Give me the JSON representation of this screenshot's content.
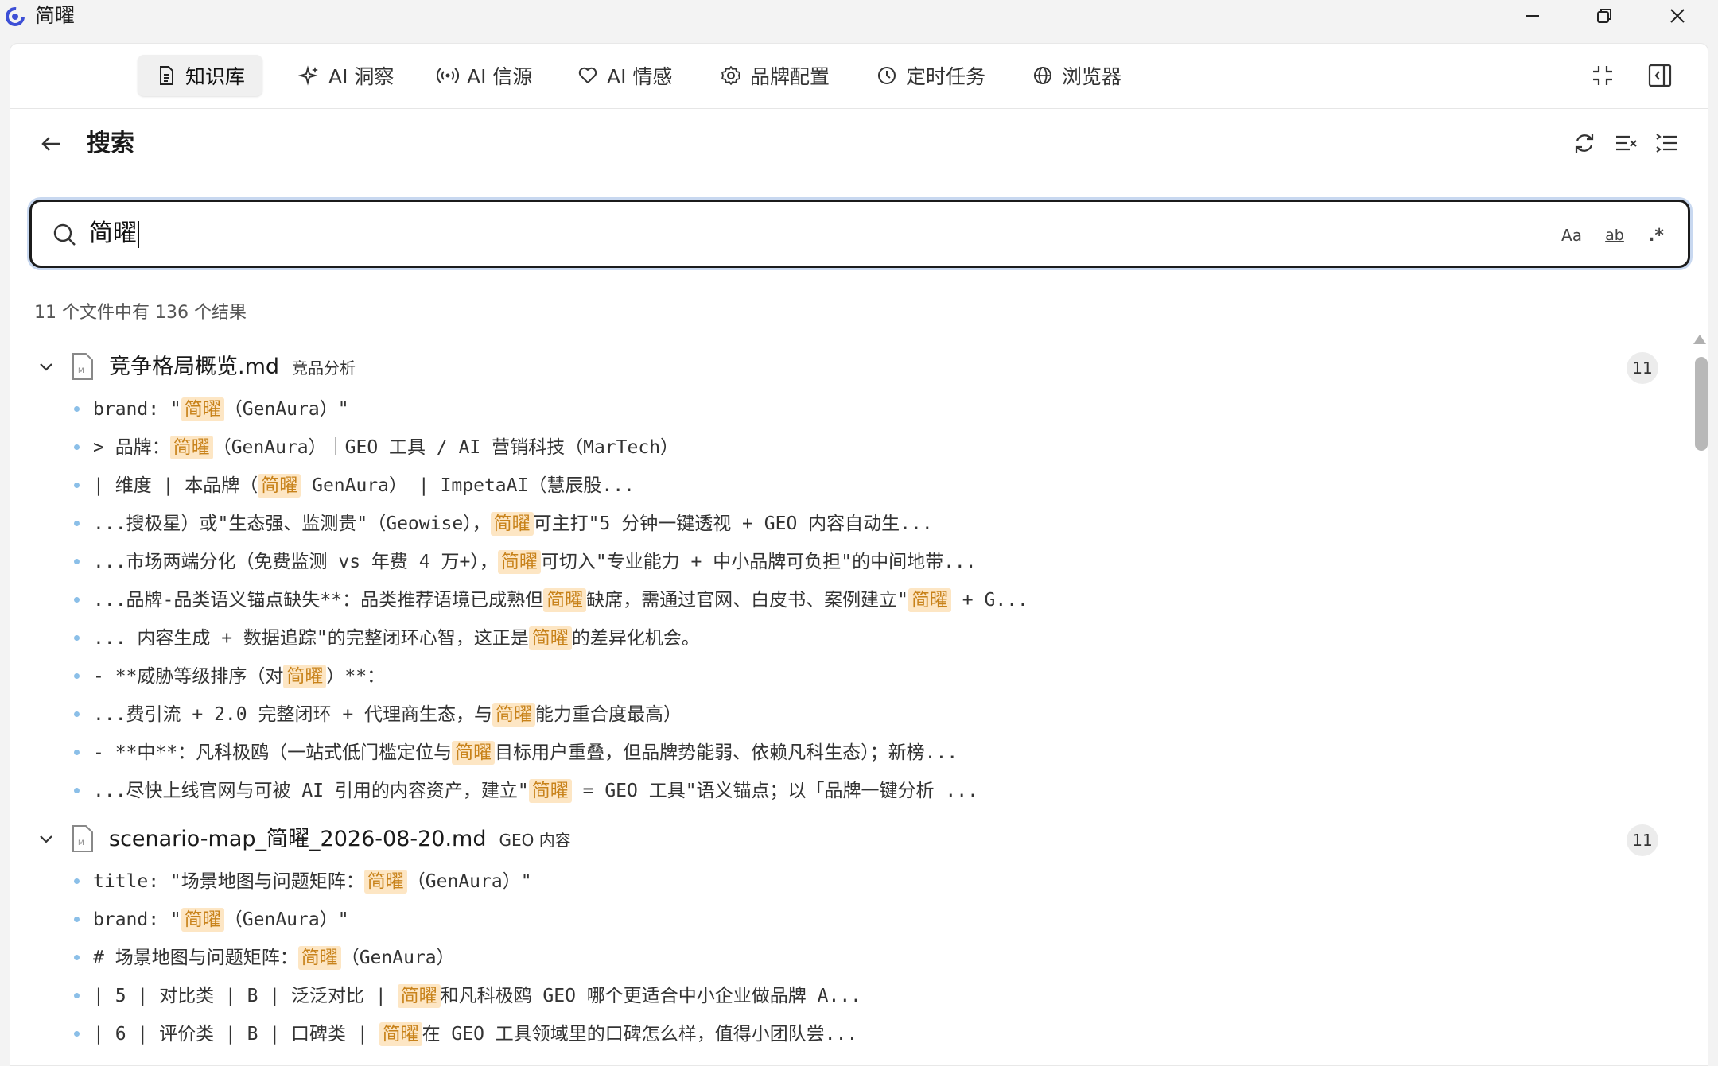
{
  "window": {
    "title": "简曜",
    "controls": [
      "minimize-icon",
      "restore-icon",
      "close-icon"
    ]
  },
  "nav": {
    "tabs": [
      {
        "label": "知识库",
        "icon": "document-icon",
        "active": true
      },
      {
        "label": "AI 洞察",
        "icon": "sparkle-icon",
        "active": false
      },
      {
        "label": "AI 信源",
        "icon": "broadcast-icon",
        "active": false
      },
      {
        "label": "AI 情感",
        "icon": "heart-icon",
        "active": false
      },
      {
        "label": "品牌配置",
        "icon": "gear-icon",
        "active": false
      },
      {
        "label": "定时任务",
        "icon": "clock-icon",
        "active": false
      },
      {
        "label": "浏览器",
        "icon": "globe-icon",
        "active": false
      }
    ],
    "right_icons": [
      "collapse-icon",
      "sidebar-toggle-icon"
    ]
  },
  "subheader": {
    "title": "搜索",
    "icons": [
      "refresh-icon",
      "clear-results-icon",
      "collapse-all-icon"
    ]
  },
  "search": {
    "value": "简曜",
    "options": {
      "match_case": "Aa",
      "whole_word": "ab",
      "regex": ".*"
    }
  },
  "summary": "11 个文件中有 136 个结果",
  "accent_color": "#c8821a",
  "highlight_bg": "#fde6c4",
  "files": [
    {
      "name": "竞争格局概览.md",
      "tag": "竞品分析",
      "count": "11",
      "matches": [
        {
          "pre": "brand: \"",
          "hl": "简曜",
          "post": "（GenAura）\""
        },
        {
          "pre": "> 品牌：",
          "hl": "简曜",
          "post": "（GenAura）｜GEO 工具 / AI 营销科技（MarTech）"
        },
        {
          "pre": "| 维度 | 本品牌（",
          "hl": "简曜",
          "post": " GenAura） | ImpetaAI（慧辰股..."
        },
        {
          "pre": "...搜极星）或\"生态强、监测贵\"（Geowise），",
          "hl": "简曜",
          "post": "可主打\"5 分钟一键透视 + GEO 内容自动生..."
        },
        {
          "pre": "...市场两端分化（免费监测 vs 年费 4 万+），",
          "hl": "简曜",
          "post": "可切入\"专业能力 + 中小品牌可负担\"的中间地带..."
        },
        {
          "pre": "...品牌-品类语义锚点缺失**：品类推荐语境已成熟但",
          "hl": "简曜",
          "post": "缺席，需通过官网、白皮书、案例建立\"",
          "hl2": "简曜",
          "post2": " + G..."
        },
        {
          "pre": "... 内容生成 + 数据追踪\"的完整闭环心智，这正是",
          "hl": "简曜",
          "post": "的差异化机会。"
        },
        {
          "pre": "- **威胁等级排序（对",
          "hl": "简曜",
          "post": "）**："
        },
        {
          "pre": "...费引流 + 2.0 完整闭环 + 代理商生态，与",
          "hl": "简曜",
          "post": "能力重合度最高）"
        },
        {
          "pre": "- **中**：凡科极鸥（一站式低门槛定位与",
          "hl": "简曜",
          "post": "目标用户重叠，但品牌势能弱、依赖凡科生态）；新榜..."
        },
        {
          "pre": "...尽快上线官网与可被 AI 引用的内容资产，建立\"",
          "hl": "简曜",
          "post": " = GEO 工具\"语义锚点；以「品牌一键分析 ..."
        }
      ]
    },
    {
      "name": "scenario-map_简曜_2026-08-20.md",
      "tag": "GEO 内容",
      "count": "11",
      "matches": [
        {
          "pre": "title: \"场景地图与问题矩阵：",
          "hl": "简曜",
          "post": "（GenAura）\""
        },
        {
          "pre": "brand: \"",
          "hl": "简曜",
          "post": "（GenAura）\""
        },
        {
          "pre": "# 场景地图与问题矩阵：",
          "hl": "简曜",
          "post": "（GenAura）"
        },
        {
          "pre": "| 5 | 对比类 | B | 泛泛对比 | ",
          "hl": "简曜",
          "post": "和凡科极鸥 GEO 哪个更适合中小企业做品牌 A..."
        },
        {
          "pre": "| 6 | 评价类 | B | 口碑类 | ",
          "hl": "简曜",
          "post": "在 GEO 工具领域里的口碑怎么样，值得小团队尝..."
        }
      ]
    }
  ]
}
